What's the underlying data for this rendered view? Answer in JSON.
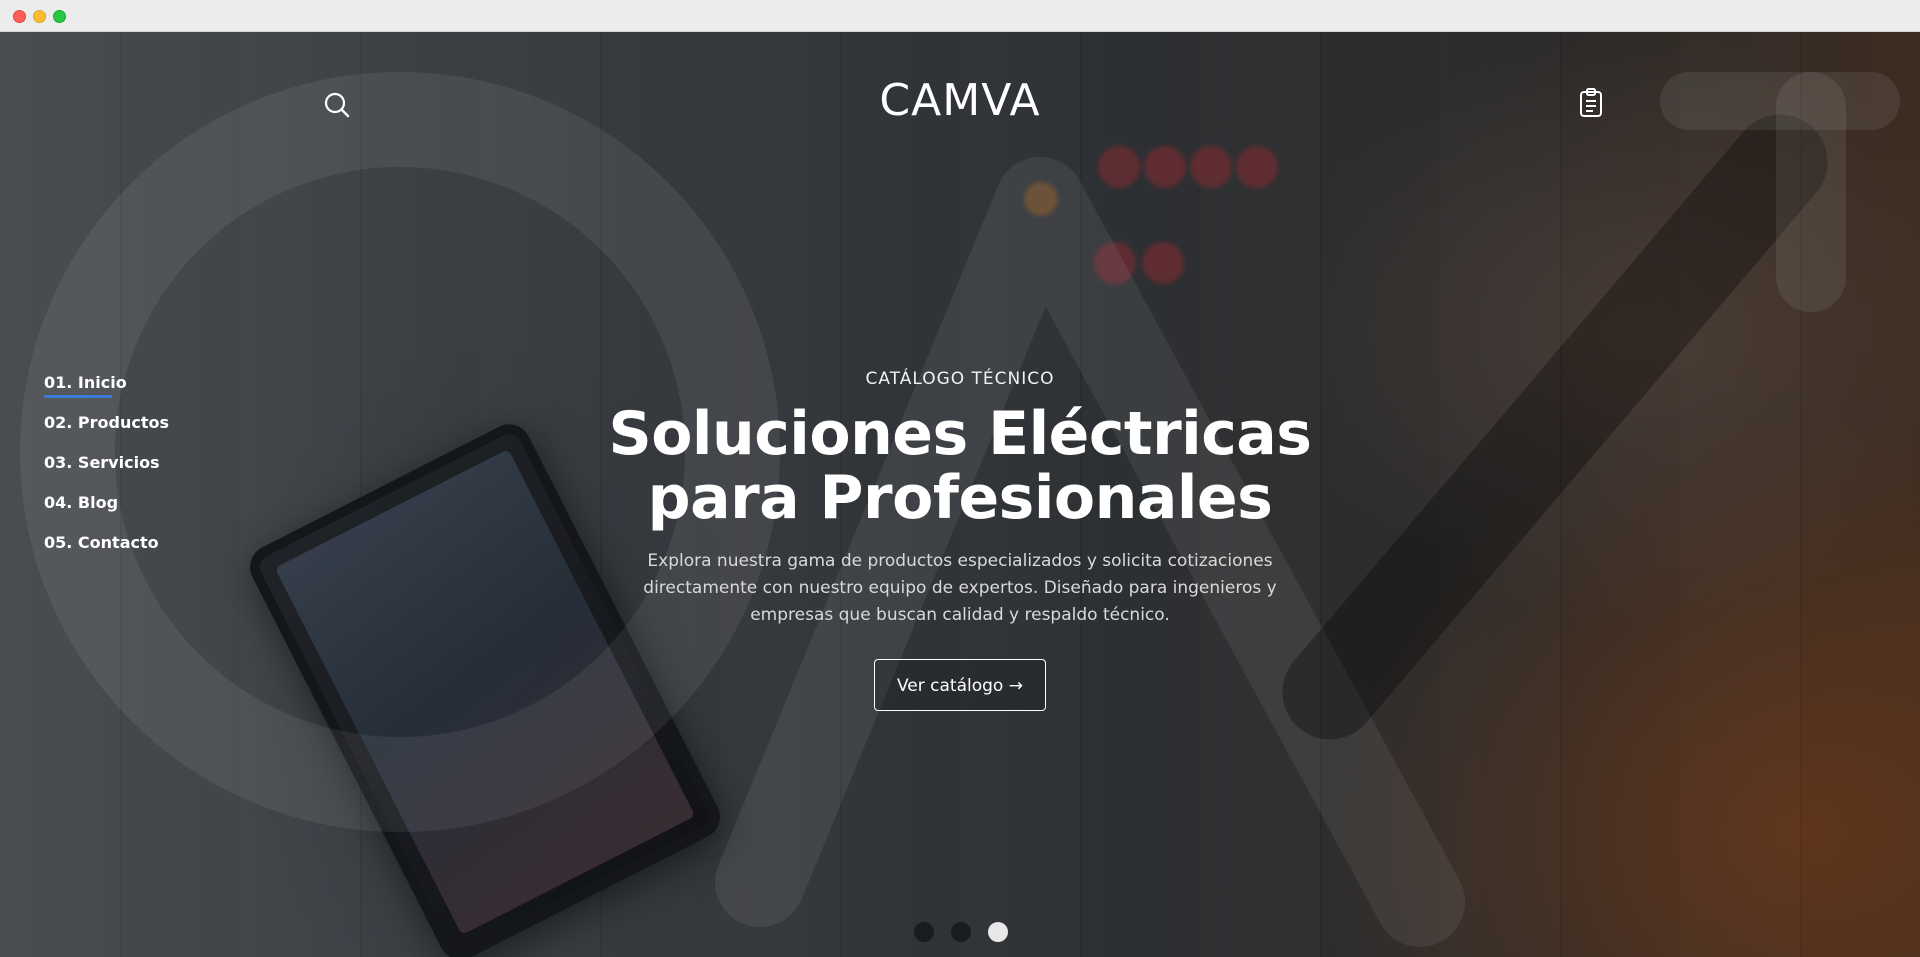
{
  "window": {
    "controls": [
      "close",
      "minimize",
      "maximize"
    ]
  },
  "header": {
    "logo_text": "CAMVA",
    "search_icon": "search-icon",
    "quote_icon": "clipboard-icon"
  },
  "side_nav": {
    "items": [
      {
        "label": "01. Inicio",
        "active": true
      },
      {
        "label": "02. Productos",
        "active": false
      },
      {
        "label": "03. Servicios",
        "active": false
      },
      {
        "label": "04. Blog",
        "active": false
      },
      {
        "label": "05. Contacto",
        "active": false
      }
    ],
    "active_color": "#3a7bd5"
  },
  "hero": {
    "eyebrow": "CATÁLOGO TÉCNICO",
    "headline_line1": "Soluciones Eléctricas",
    "headline_line2": "para Profesionales",
    "description": "Explora nuestra gama de productos especializados y solicita cotizaciones directamente con nuestro equipo de expertos. Diseñado para ingenieros y empresas que buscan calidad y respaldo técnico.",
    "cta_label": "Ver catálogo →"
  },
  "carousel": {
    "slide_count": 3,
    "active_slide": 3
  },
  "scroll_icon": "chevron-down-icon"
}
